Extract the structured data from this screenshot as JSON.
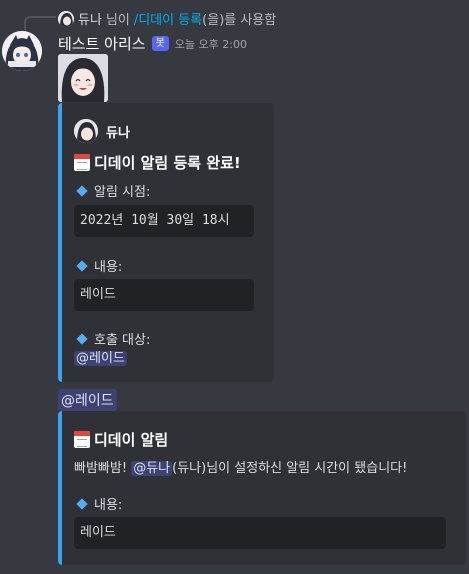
{
  "reply": {
    "user": "듀나",
    "suffix": "님이",
    "command": "/디데이 등록",
    "tail": "(을)를 사용함"
  },
  "message": {
    "author": "테스트 아리스",
    "badge": "봇",
    "timestamp": "오늘 오후 2:00"
  },
  "embed1": {
    "author": "듀나",
    "title": "디데이 알림 등록 완료!",
    "fields": [
      {
        "name": "알림 시점:",
        "value": "2022년 10월 30일 18시"
      },
      {
        "name": "내용:",
        "value": "레이드"
      },
      {
        "name": "호출 대상:",
        "value": "@레이드"
      }
    ]
  },
  "role_mention": "@레이드",
  "embed2": {
    "title": "디데이 알림",
    "desc_pre": "빠밤빠밤!",
    "desc_mention": "@듀나",
    "desc_post": "(듀나)님이 설정하신 알림 시간이 됐습니다!",
    "field_name": "내용:",
    "field_value": "레이드"
  },
  "colors": {
    "background": "#36393f",
    "embed_bg": "#2f3136",
    "embed_border": "#3ba4f0",
    "bot_badge": "#5865f2",
    "command_link": "#00aff4",
    "mention_bg": "#3e4270"
  },
  "icons": {
    "calendar": "calendar-icon",
    "bullet": "blue-diamond-icon"
  }
}
